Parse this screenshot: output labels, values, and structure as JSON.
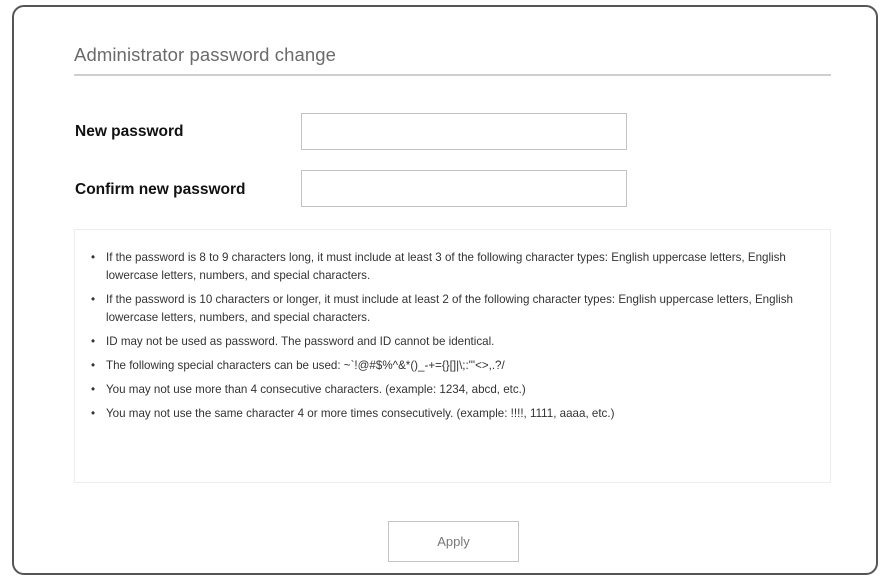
{
  "dialog": {
    "title": "Administrator password change"
  },
  "form": {
    "new_password_label": "New password",
    "new_password_value": "",
    "confirm_password_label": "Confirm new password",
    "confirm_password_value": ""
  },
  "rules": [
    "If the password is 8 to 9 characters long, it must include at least 3 of the following character types: English uppercase letters, English lowercase letters, numbers, and special characters.",
    "If the password is 10 characters or longer, it must include at least 2 of the following character types: English uppercase letters, English lowercase letters, numbers, and special characters.",
    "ID may not be used as password. The password and ID cannot be identical.",
    "The following special characters can be used: ~`!@#$%^&*()_-+={}[]|\\;:\"'<>,.?/",
    "You may not use more than 4 consecutive characters. (example: 1234, abcd, etc.)",
    "You may not use the same character 4 or more times consecutively. (example: !!!!, 1111, aaaa, etc.)"
  ],
  "actions": {
    "apply_label": "Apply"
  }
}
